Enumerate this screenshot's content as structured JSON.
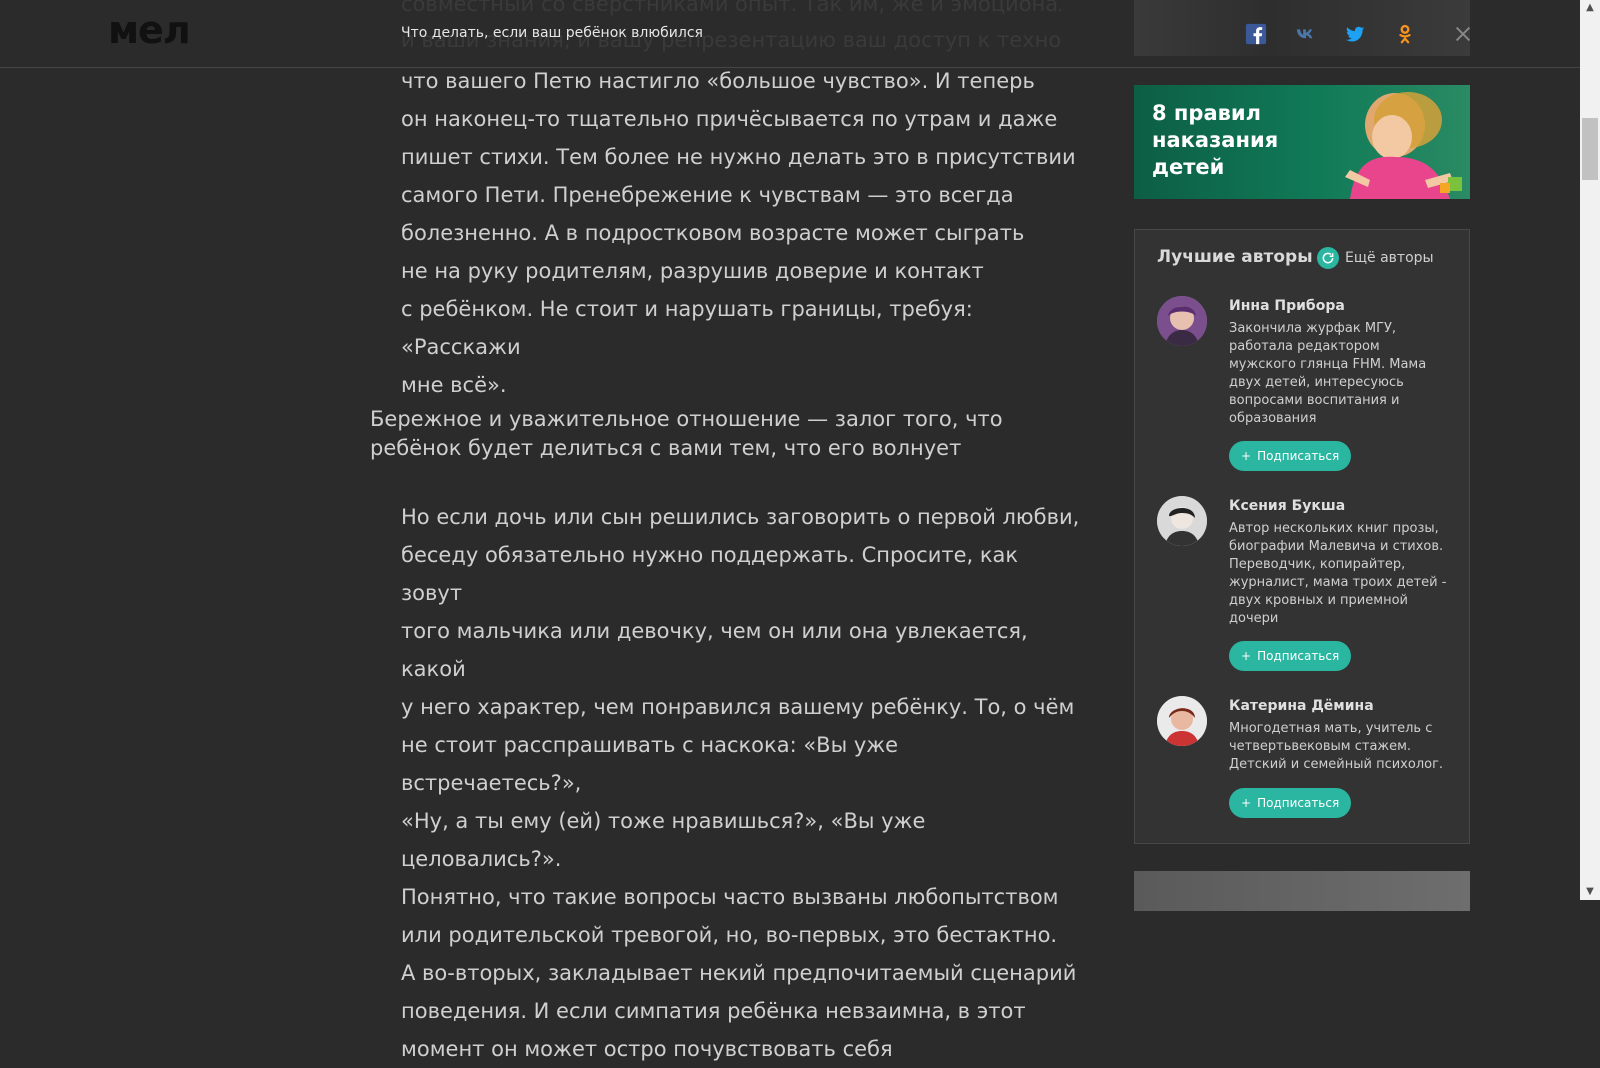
{
  "header": {
    "logo": "мел",
    "title": "Что делать, если ваш ребёнок влюбился",
    "ghost_text_1": "совместный со сверстниками опыт. Так им, же и эмоциональные",
    "ghost_text_2": "и ваши знания, и вашу репрезентацию ваш доступ к технологиям"
  },
  "share": [
    "facebook-icon",
    "vk-icon",
    "twitter-icon",
    "odnoklassniki-icon"
  ],
  "article": {
    "paragraph_top": "что вашего Петю настигло «большое чувство». И теперь\nон наконец-то тщательно причёсывается по утрам и даже\nпишет стихи. Тем более не нужно делать это в присутствии\nсамого Пети. Пренебрежение к чувствам — это всегда\nболезненно. А в подростковом возрасте может сыграть\nне на руку родителям, разрушив доверие и контакт\nс ребёнком. Не стоит и нарушать границы, требуя: «Расскажи\nмне всё».",
    "quote": "Бережное и уважительное отношение — залог того, что\nребёнок будет делиться с вами тем, что его волнует",
    "paragraph_bottom": "Но если дочь или сын решились заговорить о первой любви,\nбеседу обязательно нужно поддержать. Спросите, как зовут\nтого мальчика или девочку, чем он или она увлекается, какой\nу него характер, чем понравился вашему ребёнку. То, о чём\nне стоит расспрашивать с наскока: «Вы уже встречаетесь?»,\n«Ну, а ты ему (ей) тоже нравишься?», «Вы уже целовались?».\nПонятно, что такие вопросы часто вызваны любопытством\nили родительской тревогой, но, во-первых, это бестактно.\nА во-вторых, закладывает некий предпочитаемый сценарий\nповедения. И если симпатия ребёнка невзаимна, в этот\nмомент он может остро почувствовать себя"
  },
  "promo": {
    "text": "8 правил\nнаказания\nдетей"
  },
  "authors": {
    "title": "Лучшие авторы",
    "more": "Ещё авторы",
    "subscribe_label": "Подписаться",
    "items": [
      {
        "name": "Инна Прибора",
        "bio": "Закончила журфак МГУ,\nработала редактором\nмужского глянца FHM. Мама\nдвух детей, интересуюсь\nвопросами воспитания и\nобразования"
      },
      {
        "name": "Ксения Букша",
        "bio": "Автор нескольких книг прозы,\nбиографии Малевича и стихов.\nПереводчик, копирайтер,\nжурналист, мама троих детей -\nдвух кровных и приемной\nдочери"
      },
      {
        "name": "Катерина Дёмина",
        "bio": "Многодетная мать, учитель с\nчетвертьвековым стажем.\nДетский и семейный психолог."
      }
    ]
  },
  "colors": {
    "background": "#2b2b2b",
    "accent": "#2ab6a0",
    "promo_green": "#107a57"
  }
}
